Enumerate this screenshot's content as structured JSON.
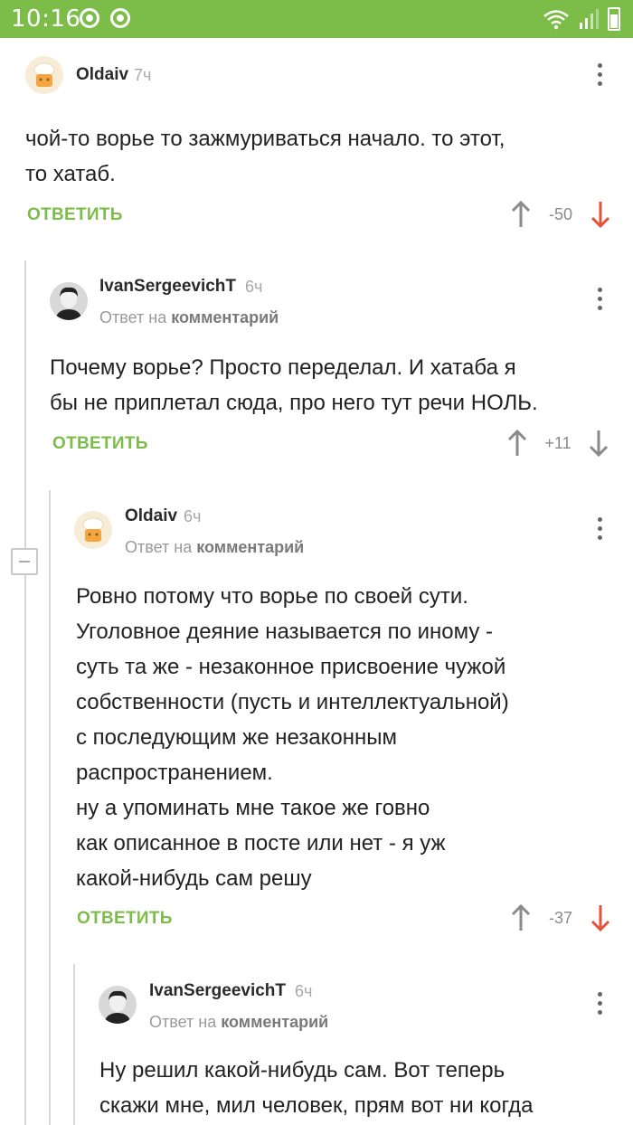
{
  "status_bar": {
    "time": "10:16"
  },
  "comments": [
    {
      "author": "Oldaiv",
      "ago": "7ч",
      "body": "чой-то ворье то зажмуриваться начало. то этот,\nто хатаб.",
      "reply_label": "ОТВЕТИТЬ",
      "score": "-50",
      "avatar": "chef-avatar"
    },
    {
      "author": "IvanSergeevichT",
      "ago": "6ч",
      "reply_prefix": "Ответ на",
      "reply_target": "комментарий",
      "body": "Почему ворье? Просто переделал. И хатаба я\nбы не приплетал сюда, про него тут речи НОЛЬ.",
      "reply_label": "ОТВЕТИТЬ",
      "score": "+11",
      "avatar": "photo-avatar"
    },
    {
      "author": "Oldaiv",
      "ago": "6ч",
      "reply_prefix": "Ответ на",
      "reply_target": "комментарий",
      "body": "Ровно потому что ворье по своей сути.\nУголовное деяние называется по иному -\nсуть та же - незаконное присвоение чужой\nсобственности (пусть и интеллектуальной)\nс последующим же незаконным\nраспространением.\nну а упоминать мне такое же говно\nкак описанное в посте или нет - я уж\nкакой-нибудь сам решу",
      "reply_label": "ОТВЕТИТЬ",
      "score": "-37",
      "avatar": "chef-avatar"
    },
    {
      "author": "IvanSergeevichT",
      "ago": "6ч",
      "reply_prefix": "Ответ на",
      "reply_target": "комментарий",
      "body": "Ну решил какой-нибудь сам. Вот теперь\nскажи мне, мил человек, прям вот ни когда",
      "avatar": "photo-avatar"
    }
  ],
  "colors": {
    "accent_green": "#7cbd4a",
    "downvote_red": "#e2533b",
    "neutral_arrow": "#8a8a8a"
  }
}
